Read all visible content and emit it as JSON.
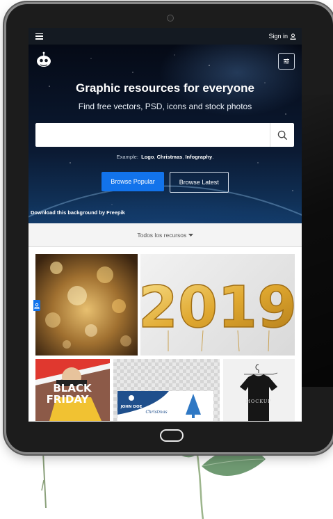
{
  "topbar": {
    "signin_label": "Sign in"
  },
  "hero": {
    "title": "Graphic resources for everyone",
    "subtitle": "Find free vectors, PSD, icons and stock photos",
    "search_placeholder": "",
    "example_label": "Example:",
    "examples": [
      "Logo",
      "Christmas",
      "Infography"
    ],
    "browse_popular": "Browse Popular",
    "browse_latest": "Browse Latest",
    "credit": "Download this background by Freepik"
  },
  "filter": {
    "label": "Todos los recursos"
  },
  "thumbnails": {
    "year_text": "2019",
    "black_friday_line1": "BLACK",
    "black_friday_line2": "FRIDAY",
    "card_name": "JOHN DOE",
    "card_word": "Christmas",
    "mockup_text": "MOCKUP"
  },
  "colors": {
    "accent": "#1273eb",
    "topbar": "#141a22"
  }
}
